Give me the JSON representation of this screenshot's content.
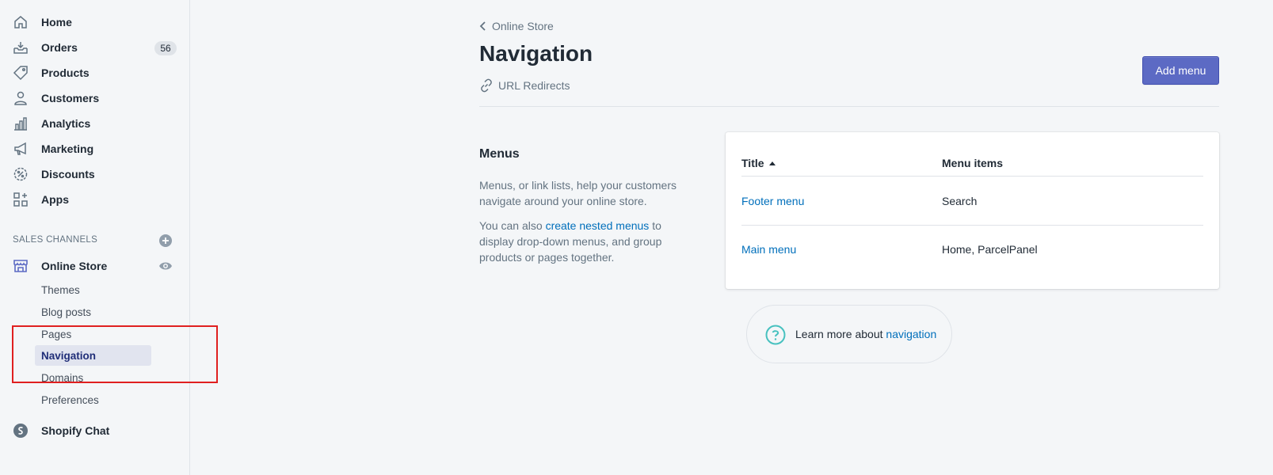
{
  "sidebar": {
    "items": [
      {
        "label": "Home",
        "icon": "home-icon"
      },
      {
        "label": "Orders",
        "icon": "orders-icon",
        "badge": "56"
      },
      {
        "label": "Products",
        "icon": "tag-icon"
      },
      {
        "label": "Customers",
        "icon": "person-icon"
      },
      {
        "label": "Analytics",
        "icon": "chart-icon"
      },
      {
        "label": "Marketing",
        "icon": "megaphone-icon"
      },
      {
        "label": "Discounts",
        "icon": "discount-icon"
      },
      {
        "label": "Apps",
        "icon": "apps-icon"
      }
    ],
    "sales_channels_title": "SALES CHANNELS",
    "online_store": {
      "label": "Online Store",
      "sub_items": [
        "Themes",
        "Blog posts",
        "Pages",
        "Navigation",
        "Domains",
        "Preferences"
      ],
      "active": "Navigation"
    },
    "shopify_chat": "Shopify Chat"
  },
  "header": {
    "breadcrumb": "Online Store",
    "title": "Navigation",
    "url_redirects": "URL Redirects",
    "add_menu": "Add menu"
  },
  "menus": {
    "heading": "Menus",
    "description": "Menus, or link lists, help your customers navigate around your online store.",
    "desc2_before": "You can also ",
    "desc2_link": "create nested menus",
    "desc2_after": " to display drop-down menus, and group products or pages together."
  },
  "table": {
    "col_title": "Title",
    "col_items": "Menu items",
    "rows": [
      {
        "title": "Footer menu",
        "items": "Search"
      },
      {
        "title": "Main menu",
        "items": "Home, ParcelPanel"
      }
    ]
  },
  "learn_more": {
    "prefix": "Learn more about ",
    "link": "navigation"
  },
  "colors": {
    "accent": "#5c6ac4",
    "link": "#006fbb",
    "active_bg": "#e1e4ef",
    "highlight": "#e02020"
  }
}
